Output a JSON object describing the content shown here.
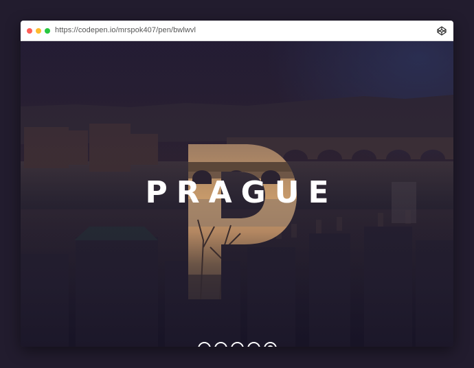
{
  "browser": {
    "url": "https://codepen.io/mrspok407/pen/bwlwvl",
    "codepen_icon": "codepen-icon",
    "traffic_lights": [
      "close-dot",
      "minimize-dot",
      "maximize-dot"
    ]
  },
  "slide": {
    "title": "PRAGUE",
    "big_letter": "P",
    "background": "prague-city-panorama-with-bridges-at-dusk"
  },
  "pagination": {
    "total": 5,
    "active_index": 4
  },
  "colors": {
    "page_background": "#221c2e",
    "topbar": "#ffffff",
    "overlay": "#1e1834",
    "title": "#ffffff",
    "dot_close": "#ff5f57",
    "dot_minimize": "#febc2e",
    "dot_maximize": "#28c840"
  }
}
